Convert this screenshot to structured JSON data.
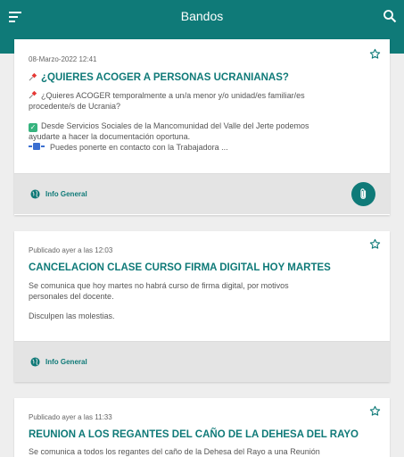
{
  "app": {
    "title": "Bandos"
  },
  "colors": {
    "accent": "#0f7a78",
    "background": "#eeeeee",
    "footer": "#e4e4e4"
  },
  "icons": {
    "menu": "menu-icon",
    "search": "search-icon",
    "star": "star-outline-icon",
    "globe": "globe-icon",
    "attach": "paperclip-icon",
    "pin": "pushpin-icon",
    "check": "check-mark-icon",
    "phone": "telephone-icon"
  },
  "cards": [
    {
      "date": "08-Marzo-2022 12:41",
      "headline": "¿QUIERES ACOGER A PERSONAS UCRANIANAS?",
      "body": [
        "¿Quieres ACOGER temporalmente a un/a menor y/o unidad/es familiar/es",
        "procedente/s de Ucrania?",
        "Desde Servicios Sociales de la Mancomunidad del Valle del Jerte podemos",
        "ayudarte a hacer la documentación oportuna.",
        "Puedes ponerte en contacto con la Trabajadora ..."
      ],
      "category": "Info General",
      "has_attachment": true
    },
    {
      "date": "Publicado ayer a las 12:03",
      "headline": "CANCELACION CLASE CURSO FIRMA DIGITAL HOY MARTES",
      "body": [
        "Se comunica que hoy martes no habrá curso de firma digital, por motivos",
        "personales del docente.",
        "Disculpen las molestias."
      ],
      "category": "Info General",
      "has_attachment": false
    },
    {
      "date": "Publicado ayer a las 11:33",
      "headline": "REUNION A LOS REGANTES DEL CAÑO DE LA DEHESA DEL RAYO",
      "body": [
        "Se comunica a todos los regantes del caño de la Dehesa del Rayo a una Reunión"
      ]
    }
  ]
}
